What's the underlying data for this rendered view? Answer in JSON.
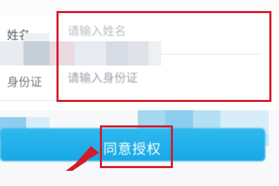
{
  "form": {
    "name_label": "姓名",
    "name_placeholder": "请输入姓名",
    "id_label": "身份证",
    "id_placeholder": "请输入身份证"
  },
  "actions": {
    "agree_label": "同意授权"
  },
  "colors": {
    "button": "#17a8e6",
    "highlight": "#d51a2a",
    "arrow": "#d51a2a"
  }
}
